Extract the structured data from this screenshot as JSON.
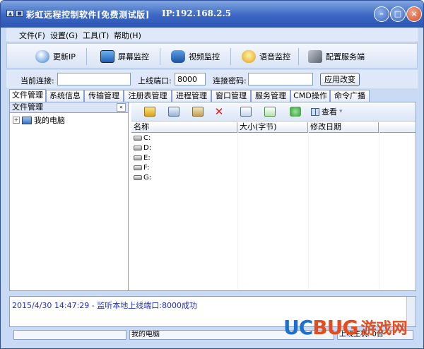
{
  "app": {
    "title": "彩虹远程控制软件[免费测试版]",
    "ip": "IP:192.168.2.5"
  },
  "menu": [
    "文件(F)",
    "设置(G)",
    "工具(T)",
    "帮助(H)"
  ],
  "toolbar": {
    "update_ip": "更新IP",
    "screen": "屏幕监控",
    "video": "视频监控",
    "voice": "语音监控",
    "config": "配置服务端"
  },
  "connection": {
    "current_label": "当前连接:",
    "current_value": "",
    "port_label": "上线端口:",
    "port_value": "8000",
    "password_label": "连接密码:",
    "password_value": "",
    "apply": "应用改变"
  },
  "tabs": [
    "文件管理",
    "系统信息",
    "传输管理",
    "注册表管理",
    "进程管理",
    "窗口管理",
    "服务管理",
    "CMD操作",
    "命令广播"
  ],
  "left_panel": {
    "header": "文件管理",
    "collapse": "«",
    "tree_expander": "+",
    "tree_root": "我的电脑"
  },
  "file_toolbar": {
    "view_label": "查看",
    "view_arrow": "▾"
  },
  "columns": [
    "名称",
    "大小(字节)",
    "修改日期"
  ],
  "drives": [
    "C:",
    "D:",
    "E:",
    "F:",
    "G:"
  ],
  "log": "2015/4/30 14:47:29 - 监听本地上线端口:8000成功",
  "status": {
    "left": "",
    "center": "我的电脑",
    "right": "上线主机: 0台"
  },
  "watermark": {
    "uc": "UC",
    "bug": "BUG",
    "cn": "游戏网"
  },
  "colors": {
    "titlebar": "#3b66c4",
    "frame": "#c9daf5",
    "log_text": "#1f2fd0"
  }
}
